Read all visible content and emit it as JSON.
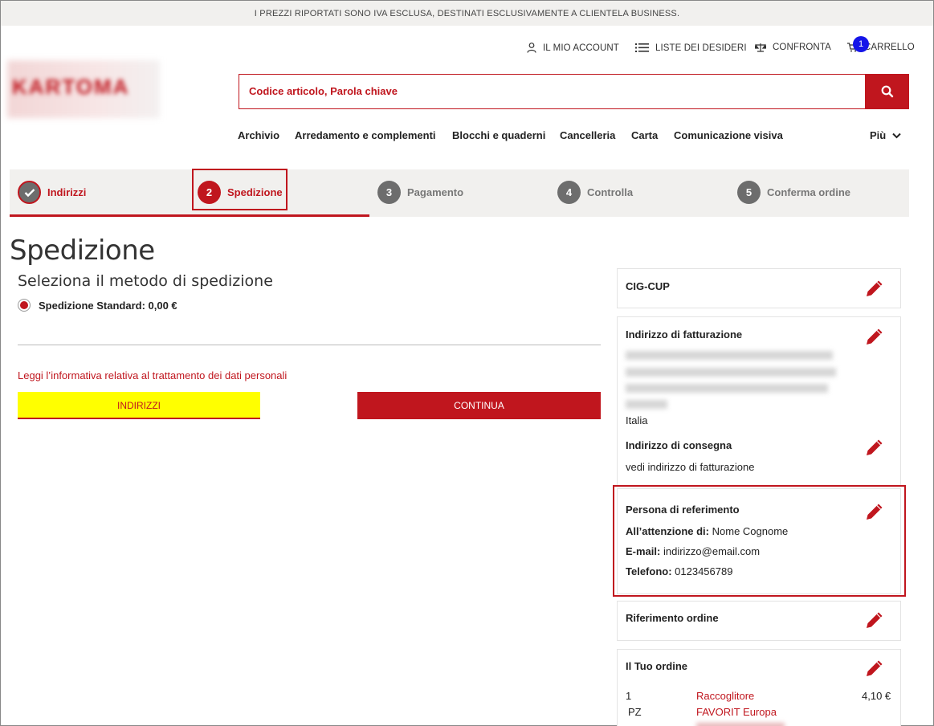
{
  "topbar": {
    "notice": "I PREZZI RIPORTATI SONO IVA ESCLUSA, DESTINATI ESCLUSIVAMENTE A CLIENTELA BUSINESS."
  },
  "utility": {
    "account": "IL MIO ACCOUNT",
    "wishlists": "LISTE DEI DESIDERI",
    "compare": "CONFRONTA",
    "cart": "CARRELLO",
    "cart_count": "1"
  },
  "logo": {
    "text": "KARTOMA"
  },
  "search": {
    "placeholder": "Codice articolo, Parola chiave"
  },
  "nav": {
    "items": [
      "Archivio",
      "Arredamento e complementi",
      "Blocchi e quaderni",
      "Cancelleria",
      "Carta",
      "Comunicazione visiva"
    ],
    "more": "Più"
  },
  "steps": [
    {
      "num": "",
      "label": "Indirizzi",
      "state": "done"
    },
    {
      "num": "2",
      "label": "Spedizione",
      "state": "active"
    },
    {
      "num": "3",
      "label": "Pagamento",
      "state": "todo"
    },
    {
      "num": "4",
      "label": "Controlla",
      "state": "todo"
    },
    {
      "num": "5",
      "label": "Conferma ordine",
      "state": "todo"
    }
  ],
  "main": {
    "title": "Spedizione",
    "subtitle": "Seleziona il metodo di spedizione",
    "shipping_option": "Spedizione Standard:  0,00 €",
    "privacy_link": "Leggi l’informativa relativa al trattamento dei dati personali",
    "back_button": "INDIRIZZI",
    "continue_button": "CONTINUA"
  },
  "sidebar": {
    "cig": {
      "title": "CIG-CUP"
    },
    "billing": {
      "title": "Indirizzo di fatturazione",
      "country": "Italia"
    },
    "delivery": {
      "title": "Indirizzo di consegna",
      "text": "vedi indirizzo di fatturazione"
    },
    "contact": {
      "title": "Persona di referimento",
      "attention_label": "All’attenzione di:",
      "attention_value": "Nome Cognome",
      "email_label": "E-mail:",
      "email_value": "indirizzo@email.com",
      "phone_label": "Telefono:",
      "phone_value": "0123456789"
    },
    "order_ref": {
      "title": "Riferimento ordine"
    },
    "order": {
      "title": "Il Tuo ordine",
      "qty": "1",
      "unit": "PZ",
      "product_line1": "Raccoglitore",
      "product_line2": "FAVORIT Europa",
      "price": "4,10 €"
    }
  },
  "colors": {
    "brand": "#c0161e",
    "highlight_button": "#ffff00",
    "badge": "#1515e8"
  }
}
